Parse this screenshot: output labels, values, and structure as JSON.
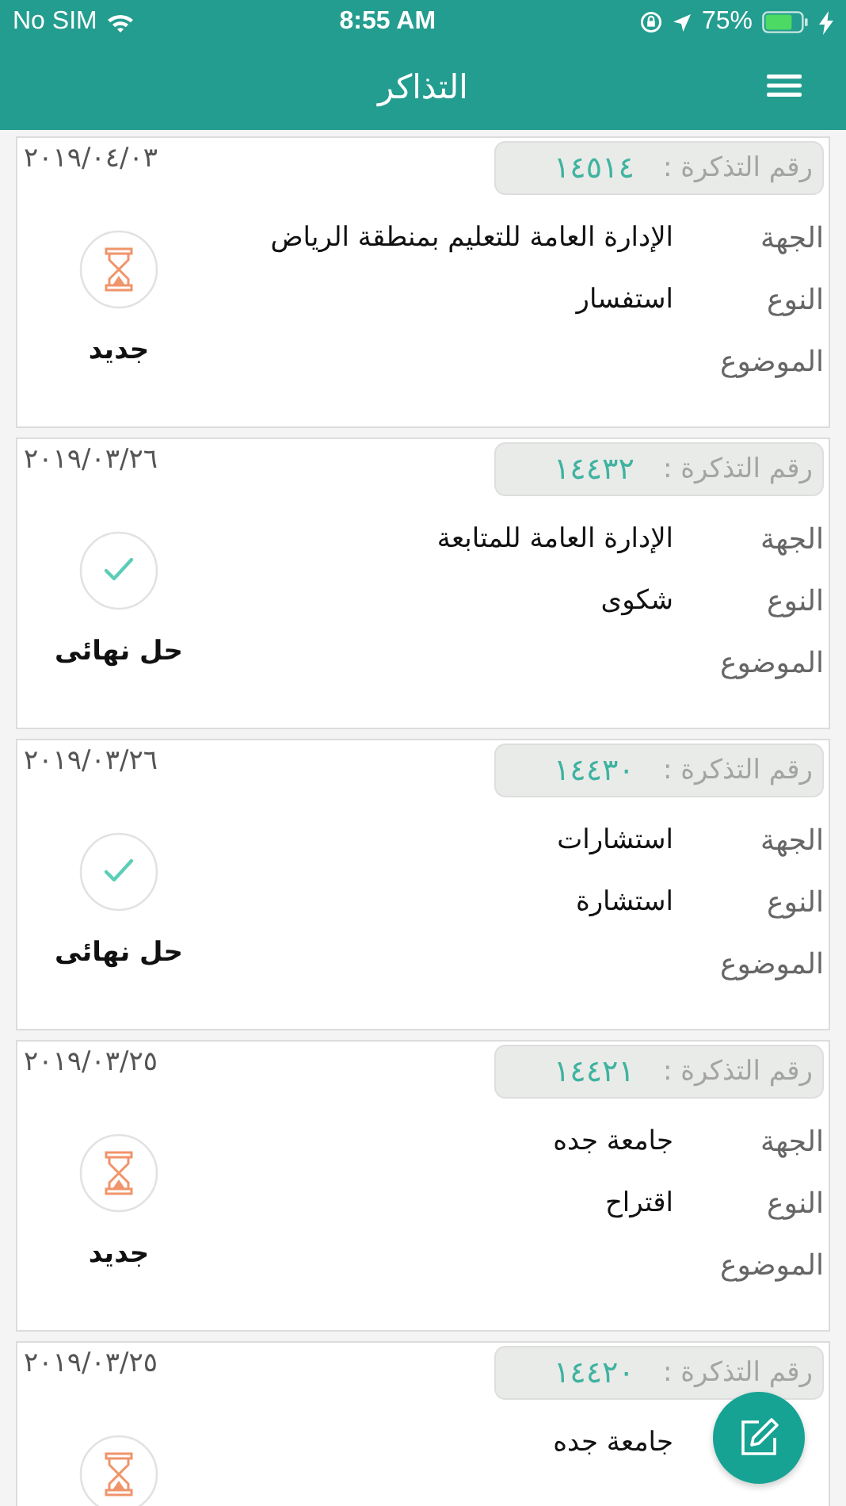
{
  "status_bar": {
    "carrier": "No SIM",
    "time": "8:55 AM",
    "battery": "75%"
  },
  "header": {
    "title": "التذاكر"
  },
  "tickets": [
    {
      "date": "٢٠١٩/٠٤/٠٣",
      "number_label": "رقم التذكرة :",
      "number": "١٤٥١٤",
      "fields": [
        {
          "label": "الجهة",
          "value": "الإدارة العامة للتعليم بمنطقة الرياض"
        },
        {
          "label": "النوع",
          "value": "استفسار"
        },
        {
          "label": "الموضوع"
        }
      ],
      "status": {
        "kind": "new",
        "label": "جديد"
      }
    },
    {
      "date": "٢٠١٩/٠٣/٢٦",
      "number_label": "رقم التذكرة :",
      "number": "١٤٤٣٢",
      "fields": [
        {
          "label": "الجهة",
          "value": "الإدارة العامة للمتابعة"
        },
        {
          "label": "النوع",
          "value": "شكوى"
        },
        {
          "label": "الموضوع"
        }
      ],
      "status": {
        "kind": "resolved",
        "label": "حل نهائى"
      }
    },
    {
      "date": "٢٠١٩/٠٣/٢٦",
      "number_label": "رقم التذكرة :",
      "number": "١٤٤٣٠",
      "fields": [
        {
          "label": "الجهة",
          "value": "استشارات"
        },
        {
          "label": "النوع",
          "value": "استشارة"
        },
        {
          "label": "الموضوع"
        }
      ],
      "status": {
        "kind": "resolved",
        "label": "حل نهائى"
      }
    },
    {
      "date": "٢٠١٩/٠٣/٢٥",
      "number_label": "رقم التذكرة :",
      "number": "١٤٤٢١",
      "fields": [
        {
          "label": "الجهة",
          "value": "جامعة جده"
        },
        {
          "label": "النوع",
          "value": "اقتراح"
        },
        {
          "label": "الموضوع"
        }
      ],
      "status": {
        "kind": "new",
        "label": "جديد"
      }
    },
    {
      "date": "٢٠١٩/٠٣/٢٥",
      "number_label": "رقم التذكرة :",
      "number": "١٤٤٢٠",
      "fields": [
        {
          "value": "جامعة جده"
        }
      ],
      "status": {
        "kind": "new"
      }
    }
  ]
}
